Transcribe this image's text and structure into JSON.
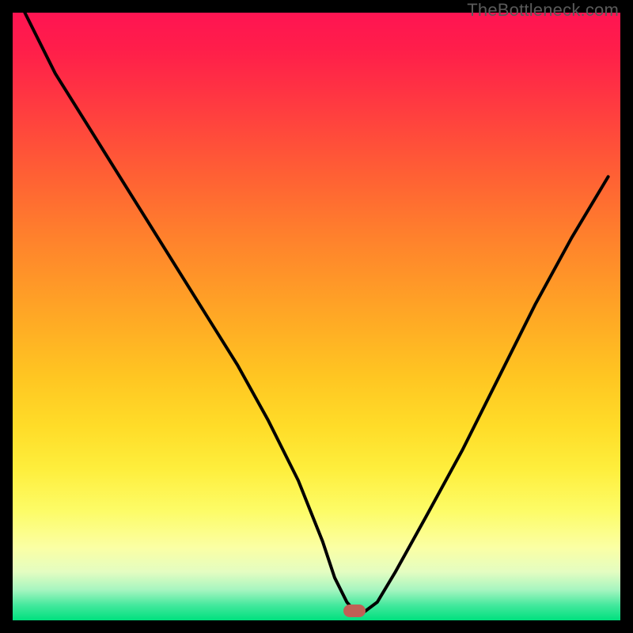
{
  "watermark": "TheBottleneck.com",
  "colors": {
    "background": "#000000",
    "gradient_top": "#ff1452",
    "gradient_bottom": "#00e07e",
    "curve": "#000000",
    "marker": "#c06055"
  },
  "chart_data": {
    "type": "line",
    "title": "",
    "xlabel": "",
    "ylabel": "",
    "xlim": [
      0,
      100
    ],
    "ylim": [
      0,
      100
    ],
    "grid": false,
    "legend": false,
    "series": [
      {
        "name": "bottleneck-curve",
        "x": [
          2,
          7,
          12,
          17,
          22,
          27,
          32,
          37,
          42,
          47,
          51,
          53,
          55,
          56.3,
          58,
          60,
          63,
          68,
          74,
          80,
          86,
          92,
          98
        ],
        "y": [
          100,
          90,
          82,
          74,
          66,
          58,
          50,
          42,
          33,
          23,
          13,
          7,
          3,
          1.5,
          1.5,
          3,
          8,
          17,
          28,
          40,
          52,
          63,
          73
        ]
      }
    ],
    "marker": {
      "x": 56.3,
      "y": 1.5
    },
    "note": "Axes have no visible tick labels; x and y are normalized 0–100 across the gradient panel. y represents bottleneck magnitude (100 = top/red, 0 = bottom/green)."
  }
}
